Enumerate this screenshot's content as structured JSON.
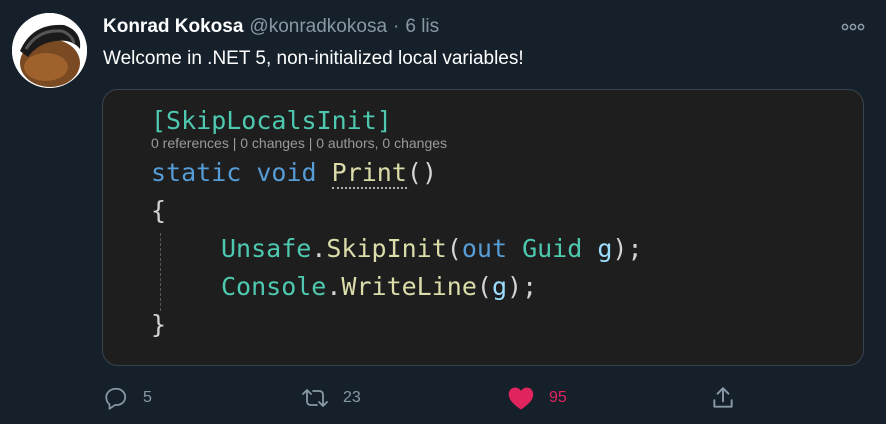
{
  "tweet": {
    "author_name": "Konrad Kokosa",
    "handle": "@konradkokosa",
    "separator": "·",
    "time": "6 lis",
    "text": "Welcome in .NET 5, non-initialized local variables!"
  },
  "code": {
    "attribute": "[SkipLocalsInit]",
    "codelens": "0 references | 0 changes | 0 authors, 0 changes",
    "kw_static": "static",
    "kw_void": "void",
    "method_name": "Print",
    "parens": "()",
    "open_brace": "{",
    "unsafe": "Unsafe",
    "dot": ".",
    "skipinit": "SkipInit",
    "open_paren": "(",
    "kw_out": "out",
    "guid": "Guid",
    "var_g": "g",
    "close_stmt": ");",
    "console": "Console",
    "writeline": "WriteLine",
    "close_brace": "}"
  },
  "actions": {
    "reply_count": "5",
    "retweet_count": "23",
    "like_count": "95"
  },
  "colors": {
    "background": "#15202b",
    "secondary_text": "#8899a6",
    "like": "#e0245e",
    "code_background": "#1e1e1e",
    "keyword": "#569cd6",
    "type": "#4ec9b0",
    "method": "#dcdcaa",
    "variable": "#9cdcfe"
  },
  "icons": [
    "avatar-image",
    "more-icon",
    "reply-icon",
    "retweet-icon",
    "heart-icon",
    "share-icon"
  ]
}
